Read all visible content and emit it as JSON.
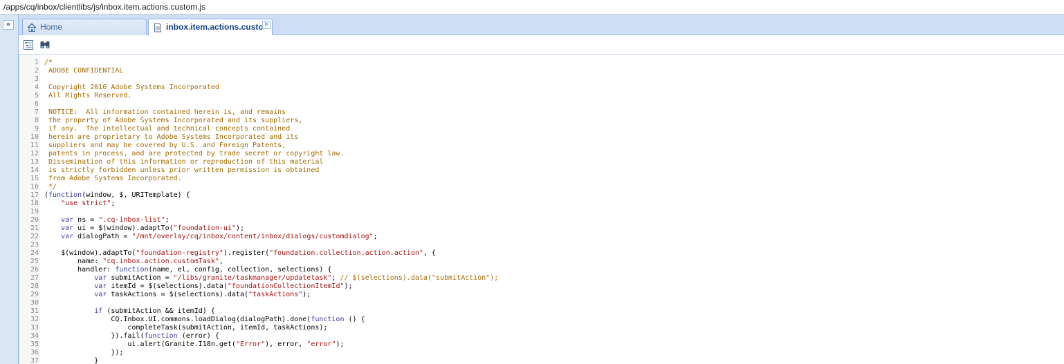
{
  "path": "/apps/cq/inbox/clientlibs/js/inbox.item.actions.custom.js",
  "tabs": [
    {
      "label": "Home",
      "icon": "home-icon",
      "active": false
    },
    {
      "label": "inbox.item.actions.custo",
      "icon": "file-icon",
      "active": true
    }
  ],
  "toolbar": {
    "tools": [
      "outline-icon",
      "binoculars-icon"
    ]
  },
  "colors": {
    "accent": "#15428b",
    "tab_border": "#99bbe8",
    "comment": "#a56a00",
    "string": "#aa1111",
    "keyword": "#3a3aa0"
  },
  "code_lines": [
    "/*",
    " ADOBE CONFIDENTIAL",
    "",
    " Copyright 2016 Adobe Systems Incorporated",
    " All Rights Reserved.",
    "",
    " NOTICE:  All information contained herein is, and remains",
    " the property of Adobe Systems Incorporated and its suppliers,",
    " if any.  The intellectual and technical concepts contained",
    " herein are proprietary to Adobe Systems Incorporated and its",
    " suppliers and may be covered by U.S. and Foreign Patents,",
    " patents in process, and are protected by trade secret or copyright law.",
    " Dissemination of this information or reproduction of this material",
    " is strictly forbidden unless prior written permission is obtained",
    " from Adobe Systems Incorporated.",
    " */",
    "(function(window, $, URITemplate) {",
    "    \"use strict\";",
    "",
    "    var ns = \".cq-inbox-list\";",
    "    var ui = $(window).adaptTo(\"foundation-ui\");",
    "    var dialogPath = \"/mnt/overlay/cq/inbox/content/inbox/dialogs/customdialog\";",
    "",
    "    $(window).adaptTo(\"foundation-registry\").register(\"foundation.collection.action.action\", {",
    "        name: \"cq.inbox.action.customTask\",",
    "        handler: function(name, el, config, collection, selections) {",
    "            var submitAction = \"/libs/granite/taskmanager/updatetask\"; // $(selections).data(\"submitAction\");",
    "            var itemId = $(selections).data(\"foundationCollectionItemId\");",
    "            var taskActions = $(selections).data(\"taskActions\");",
    "",
    "            if (submitAction && itemId) {",
    "                CQ.Inbox.UI.commons.loadDialog(dialogPath).done(function () {",
    "                    completeTask(submitAction, itemId, taskActions);",
    "                }).fail(function (error) {",
    "                    ui.alert(Granite.I18n.get(\"Error\"), error, \"error\");",
    "                });",
    "            }"
  ]
}
